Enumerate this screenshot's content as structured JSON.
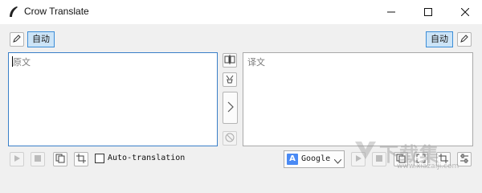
{
  "window": {
    "title": "Crow Translate"
  },
  "source": {
    "language": "自动",
    "placeholder": "原文"
  },
  "translation": {
    "language": "自动",
    "placeholder": "译文"
  },
  "options": {
    "auto_translation_label": "Auto-translation",
    "auto_translation_checked": false
  },
  "engine": {
    "selected": "Google",
    "icon_letter": "A"
  },
  "watermark": {
    "text": "下载集",
    "url": "www.xiazaiji.com"
  },
  "colors": {
    "accent": "#3c8ed8",
    "selected_lang_bg": "#cce4f7"
  }
}
